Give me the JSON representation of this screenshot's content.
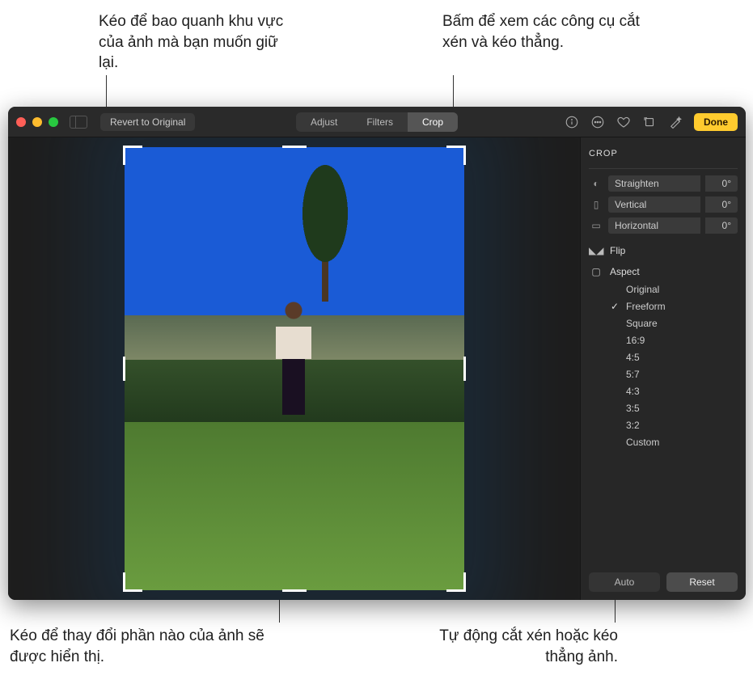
{
  "callouts": {
    "top_left": "Kéo để bao quanh khu vực của ảnh mà bạn muốn giữ lại.",
    "top_right": "Bấm để xem các công cụ cắt xén và kéo thẳng.",
    "bottom_left": "Kéo để thay đổi phần nào của ảnh sẽ được hiển thị.",
    "bottom_right": "Tự động cắt xén hoặc kéo thẳng ảnh."
  },
  "toolbar": {
    "revert": "Revert to Original",
    "adjust": "Adjust",
    "filters": "Filters",
    "crop": "Crop",
    "done": "Done"
  },
  "panel": {
    "title": "CROP",
    "straighten_label": "Straighten",
    "straighten_value": "0°",
    "vertical_label": "Vertical",
    "vertical_value": "0°",
    "horizontal_label": "Horizontal",
    "horizontal_value": "0°",
    "flip": "Flip",
    "aspect": "Aspect",
    "aspects": {
      "original": "Original",
      "freeform": "Freeform",
      "square": "Square",
      "r16_9": "16:9",
      "r4_5": "4:5",
      "r5_7": "5:7",
      "r4_3": "4:3",
      "r3_5": "3:5",
      "r3_2": "3:2",
      "custom": "Custom"
    },
    "auto": "Auto",
    "reset": "Reset"
  }
}
